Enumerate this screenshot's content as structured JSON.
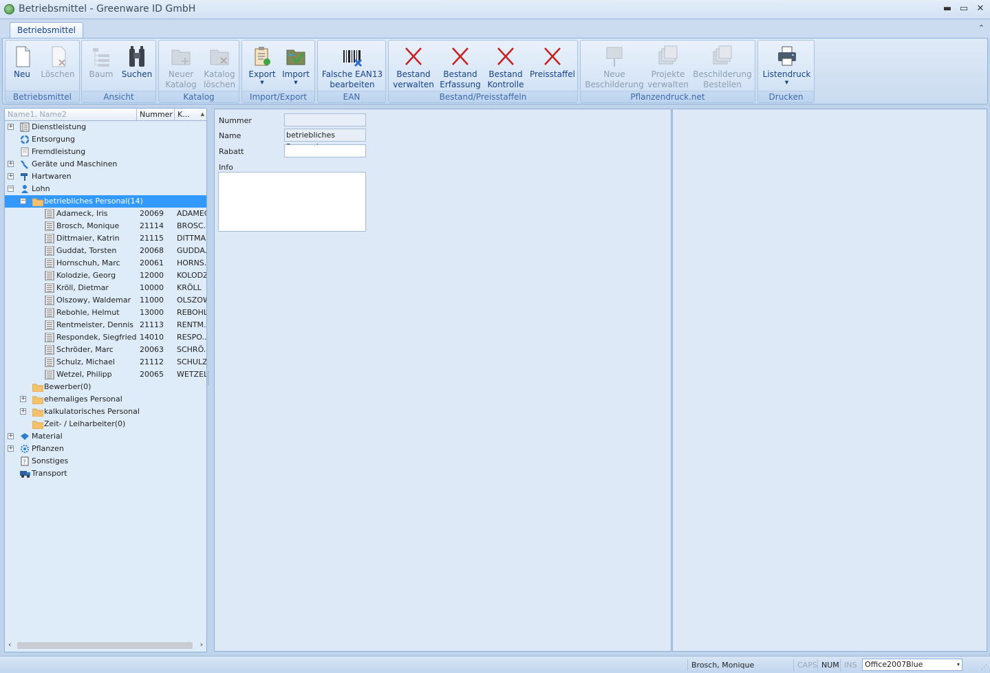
{
  "window": {
    "title": "Betriebsmittel - Greenware ID GmbH",
    "minimize": "▬",
    "maximize": "▭",
    "close": "✕"
  },
  "ribbon_tab": "Betriebsmittel",
  "ribbon_collapse": "⌃",
  "ribbon": {
    "groups": [
      {
        "label": "Betriebsmittel",
        "buttons": [
          "Neu",
          "Löschen"
        ]
      },
      {
        "label": "Ansicht",
        "buttons": [
          "Baum",
          "Suchen"
        ]
      },
      {
        "label": "Katalog",
        "buttons": [
          "Neuer\nKatalog",
          "Katalog\nlöschen"
        ]
      },
      {
        "label": "Import/Export",
        "buttons": [
          "Export",
          "Import"
        ]
      },
      {
        "label": "EAN",
        "buttons": [
          "Falsche EAN13\nbearbeiten"
        ]
      },
      {
        "label": "Bestand/Preisstaffeln",
        "buttons": [
          "Bestand\nverwalten",
          "Bestand\nErfassung",
          "Bestand\nKontrolle",
          "Preisstaffel"
        ]
      },
      {
        "label": "Pflanzendruck.net",
        "buttons": [
          "Neue\nBeschilderung",
          "Projekte\nverwalten",
          "Beschilderung\nBestellen"
        ]
      },
      {
        "label": "Drucken",
        "buttons": [
          "Listendruck"
        ]
      }
    ],
    "btn": {
      "neu": "Neu",
      "loeschen": "Löschen",
      "baum": "Baum",
      "suchen": "Suchen",
      "neuer_katalog_1": "Neuer",
      "neuer_katalog_2": "Katalog",
      "katalog_loeschen_1": "Katalog",
      "katalog_loeschen_2": "löschen",
      "export": "Export",
      "import": "Import",
      "ean_1": "Falsche EAN13",
      "ean_2": "bearbeiten",
      "bv_1": "Bestand",
      "bv_2": "verwalten",
      "be_1": "Bestand",
      "be_2": "Erfassung",
      "bk_1": "Bestand",
      "bk_2": "Kontrolle",
      "preisstaffel": "Preisstaffel",
      "nb_1": "Neue",
      "nb_2": "Beschilderung",
      "pv_1": "Projekte",
      "pv_2": "verwalten",
      "bb_1": "Beschilderung",
      "bb_2": "Bestellen",
      "listendruck": "Listendruck"
    },
    "labels": {
      "g1": "Betriebsmittel",
      "g2": "Ansicht",
      "g3": "Katalog",
      "g4": "Import/Export",
      "g5": "EAN",
      "g6": "Bestand/Preisstaffeln",
      "g7": "Pflanzendruck.net",
      "g8": "Drucken"
    }
  },
  "tree": {
    "filter_placeholder": "Name1, Name2",
    "col_nummer": "Nummer",
    "col_katalog": "K...",
    "sort_indicator": "▲",
    "nodes": [
      {
        "label": "Dienstleistung",
        "expander": "+"
      },
      {
        "label": "Entsorgung"
      },
      {
        "label": "Fremdleistung"
      },
      {
        "label": "Geräte und Maschinen",
        "expander": "+"
      },
      {
        "label": "Hartwaren",
        "expander": "+"
      },
      {
        "label": "Lohn",
        "expander": "−"
      },
      {
        "label": "betriebliches Personal(14)",
        "expander": "−",
        "selected": true
      },
      {
        "label": "Adameck, Iris",
        "nummer": "20069",
        "kat": "ADAMEC"
      },
      {
        "label": "Brosch, Monique",
        "nummer": "21114",
        "kat": "BROSC.."
      },
      {
        "label": "Dittmaier, Katrin",
        "nummer": "21115",
        "kat": "DITTMA.."
      },
      {
        "label": "Guddat, Torsten",
        "nummer": "20068",
        "kat": "GUDDA.."
      },
      {
        "label": "Hornschuh, Marc",
        "nummer": "20061",
        "kat": "HORNS.."
      },
      {
        "label": "Kolodzie, Georg",
        "nummer": "12000",
        "kat": "KOLODZI"
      },
      {
        "label": "Kröll, Dietmar",
        "nummer": "10000",
        "kat": "KRÖLL"
      },
      {
        "label": "Olszowy, Waldemar",
        "nummer": "11000",
        "kat": "OLSZOW"
      },
      {
        "label": "Rebohle, Helmut",
        "nummer": "13000",
        "kat": "REBOHLE"
      },
      {
        "label": "Rentmeister, Dennis",
        "nummer": "21113",
        "kat": "RENTM.."
      },
      {
        "label": "Respondek, Siegfried",
        "nummer": "14010",
        "kat": "RESPO.."
      },
      {
        "label": "Schröder, Marc",
        "nummer": "20063",
        "kat": "SCHRÖ.."
      },
      {
        "label": "Schulz, Michael",
        "nummer": "21112",
        "kat": "SCHULZ."
      },
      {
        "label": "Wetzel, Philipp",
        "nummer": "20065",
        "kat": "WETZEL"
      },
      {
        "label": "Bewerber(0)"
      },
      {
        "label": "ehemaliges Personal",
        "expander": "+"
      },
      {
        "label": "kalkulatorisches Personal",
        "expander": "+"
      },
      {
        "label": "Zeit- / Leiharbeiter(0)"
      },
      {
        "label": "Material",
        "expander": "+"
      },
      {
        "label": "Pflanzen",
        "expander": "+"
      },
      {
        "label": "Sonstiges"
      },
      {
        "label": "Transport"
      }
    ],
    "scroll_left": "‹",
    "scroll_right": "›"
  },
  "form": {
    "nummer_label": "Nummer",
    "nummer_value": "",
    "name_label": "Name",
    "name_value": "betriebliches Personal",
    "rabatt_label": "Rabatt",
    "rabatt_value": "",
    "info_label": "Info",
    "info_value": ""
  },
  "status": {
    "user": "Brosch, Monique",
    "caps": "CAPS",
    "num": "NUM",
    "ins": "INS",
    "theme": "Office2007Blue",
    "theme_dropdown": "▾"
  },
  "colors": {
    "selection": "#3399ff",
    "ribbon_text": "#15428b",
    "group_label": "#3e6aaa",
    "red_x": "#c62020"
  }
}
